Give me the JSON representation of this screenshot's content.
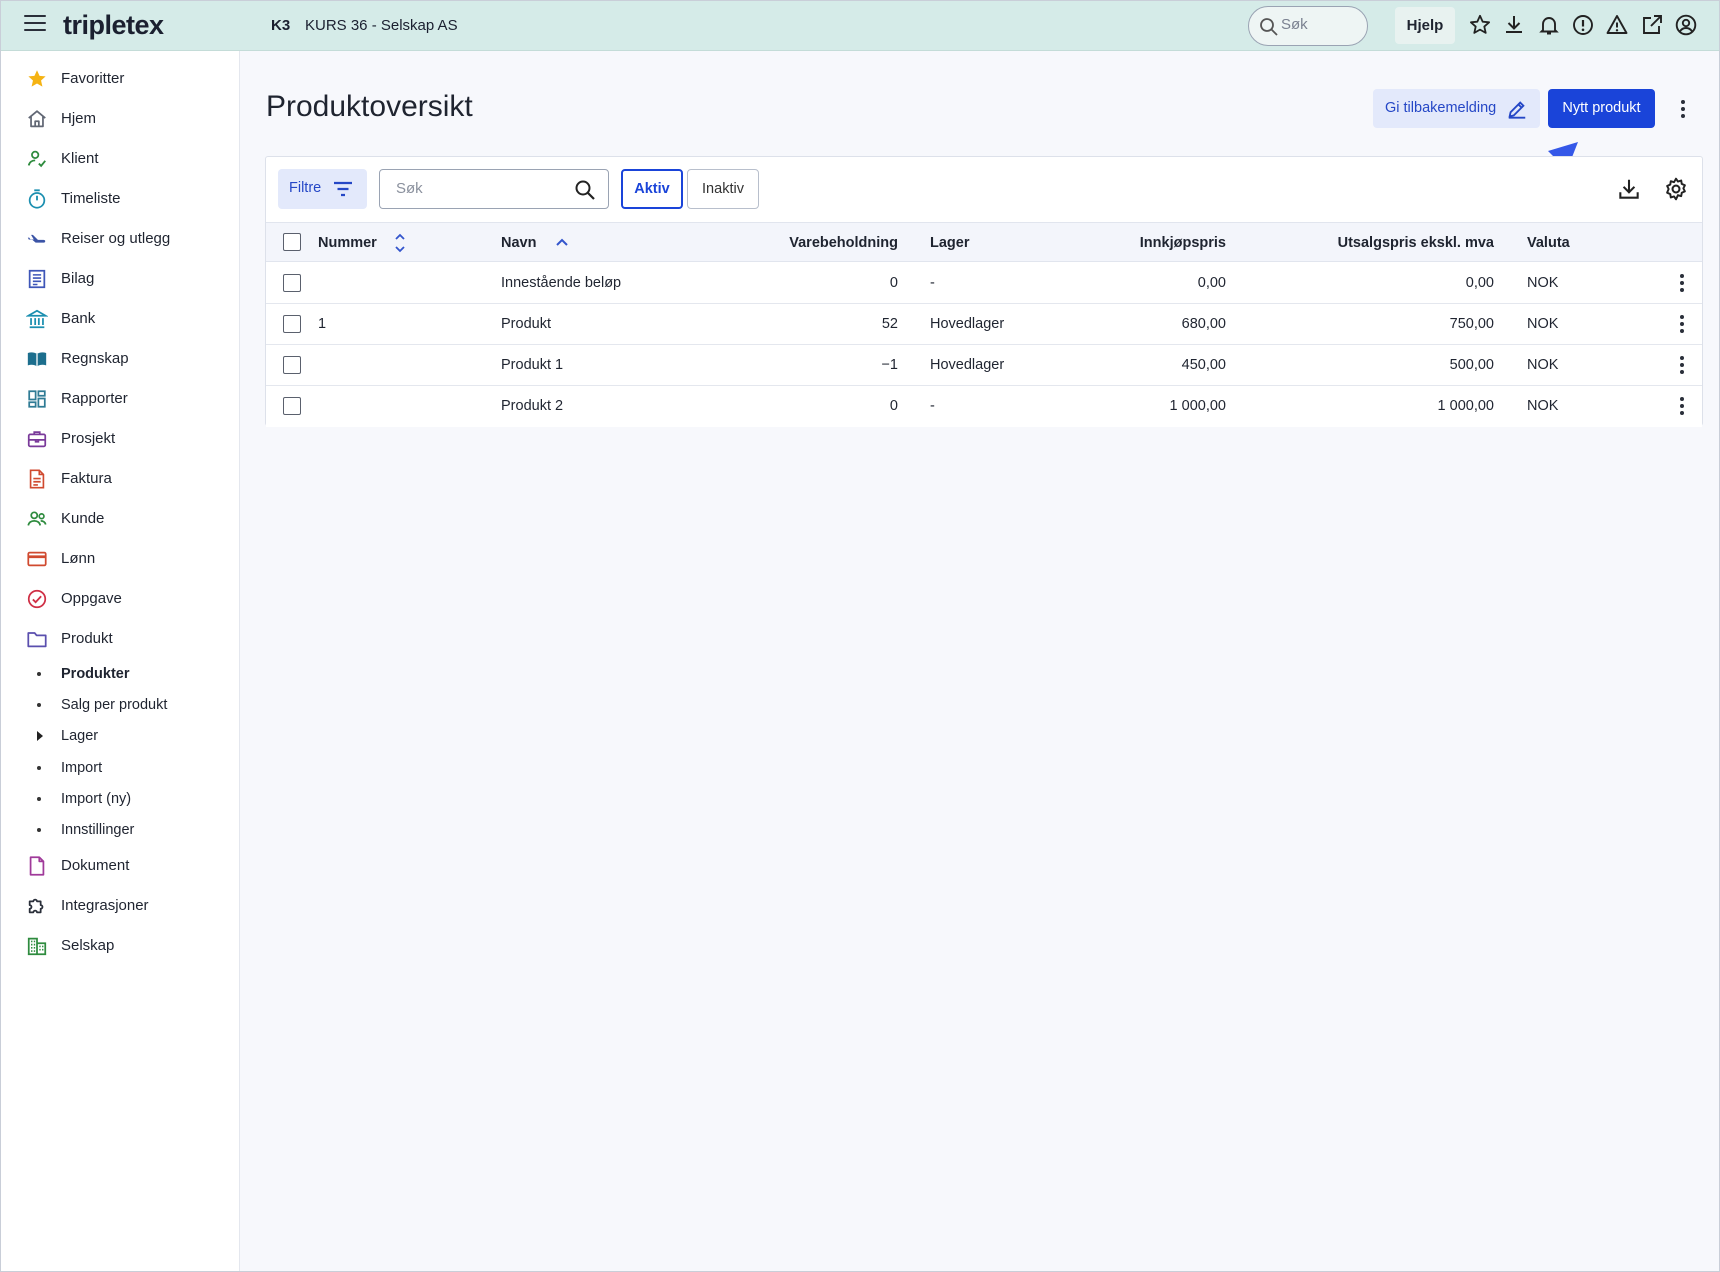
{
  "header": {
    "logo": "tripletex",
    "company_code": "K3",
    "company_name": "KURS 36 - Selskap AS",
    "search_placeholder": "Søk",
    "help_label": "Hjelp"
  },
  "sidebar": {
    "items": [
      {
        "label": "Favoritter",
        "icon": "star-icon"
      },
      {
        "label": "Hjem",
        "icon": "home-icon"
      },
      {
        "label": "Klient",
        "icon": "client-icon"
      },
      {
        "label": "Timeliste",
        "icon": "stopwatch-icon"
      },
      {
        "label": "Reiser og utlegg",
        "icon": "plane-icon"
      },
      {
        "label": "Bilag",
        "icon": "voucher-icon"
      },
      {
        "label": "Bank",
        "icon": "bank-icon"
      },
      {
        "label": "Regnskap",
        "icon": "book-icon"
      },
      {
        "label": "Rapporter",
        "icon": "dashboard-icon"
      },
      {
        "label": "Prosjekt",
        "icon": "briefcase-icon"
      },
      {
        "label": "Faktura",
        "icon": "invoice-icon"
      },
      {
        "label": "Kunde",
        "icon": "people-icon"
      },
      {
        "label": "Lønn",
        "icon": "card-icon"
      },
      {
        "label": "Oppgave",
        "icon": "check-circle-icon"
      },
      {
        "label": "Produkt",
        "icon": "folder-icon"
      }
    ],
    "sub_items": [
      {
        "label": "Produkter",
        "active": true
      },
      {
        "label": "Salg per produkt"
      },
      {
        "label": "Lager",
        "expandable": true
      },
      {
        "label": "Import"
      },
      {
        "label": "Import (ny)"
      },
      {
        "label": "Innstillinger"
      }
    ],
    "bottom_items": [
      {
        "label": "Dokument",
        "icon": "document-icon"
      },
      {
        "label": "Integrasjoner",
        "icon": "puzzle-icon"
      },
      {
        "label": "Selskap",
        "icon": "building-icon"
      }
    ]
  },
  "main": {
    "title": "Produktoversikt",
    "feedback_label": "Gi tilbakemelding",
    "new_product_label": "Nytt produkt",
    "filter_label": "Filtre",
    "search_placeholder": "Søk",
    "toggle": {
      "active": "Aktiv",
      "inactive": "Inaktiv",
      "selected": "Aktiv"
    }
  },
  "table": {
    "columns": [
      "Nummer",
      "Navn",
      "Varebeholdning",
      "Lager",
      "Innkjøpspris",
      "Utsalgspris ekskl. mva",
      "Valuta"
    ],
    "rows": [
      [
        "",
        "Innestående beløp",
        "0",
        "-",
        "0,00",
        "0,00",
        "NOK"
      ],
      [
        "1",
        "Produkt",
        "52",
        "Hovedlager",
        "680,00",
        "750,00",
        "NOK"
      ],
      [
        "",
        "Produkt 1",
        "−1",
        "Hovedlager",
        "450,00",
        "500,00",
        "NOK"
      ],
      [
        "",
        "Produkt 2",
        "0",
        "-",
        "1 000,00",
        "1 000,00",
        "NOK"
      ]
    ]
  },
  "colors": {
    "header_bg": "#d5ebe8",
    "primary": "#1a44d9",
    "annotation_arrow": "#3558e8"
  }
}
